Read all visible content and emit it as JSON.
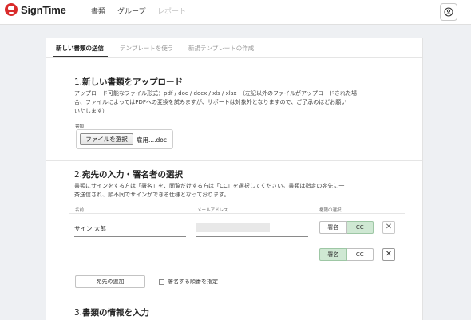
{
  "app": {
    "name": "SignTime"
  },
  "nav": {
    "items": [
      "書類",
      "グループ",
      "レポート"
    ]
  },
  "tabs": [
    "新しい書類の送信",
    "テンプレートを使う",
    "新規テンプレートの作成"
  ],
  "upload": {
    "title_num": "1.",
    "title": "新しい書類をアップロード",
    "desc_line1": "アップロード可能なファイル形式：pdf / doc / docx / xls / xlsx　（左記以外のファイルがアップロードされた場",
    "desc_line2": "合、ファイルによってはPDFへの変換を試みますが、サポートは対象外となりますので、ご了承のほどお願い",
    "desc_line3": "いたします）",
    "file_label": "書類",
    "file_button": "ファイルを選択",
    "file_name": "雇用....doc"
  },
  "recipients": {
    "title_num": "2.",
    "title": "宛先の入力・署名者の選択",
    "desc_line1": "書類にサインをする方は「署名」を、閲覧だけする方は「CC」を選択してください。書類は指定の宛先に一",
    "desc_line2": "斉送信され、順不同でサインができる仕様となっております。",
    "col_name": "名前",
    "col_email": "メールアドレス",
    "col_role": "権限の選択",
    "rows": [
      {
        "name": "サイン 太郎",
        "email": "",
        "sign_label": "署名",
        "cc_label": "CC",
        "selected": "CC"
      },
      {
        "name": "",
        "email": "",
        "sign_label": "署名",
        "cc_label": "CC",
        "selected": "署名"
      }
    ],
    "remove_icon": "✕",
    "add_button": "宛先の追加",
    "order_checkbox_label": "署名する順番を指定"
  },
  "info": {
    "title_num": "3.",
    "title": "書類の情報を入力"
  },
  "colors": {
    "brand": "#d92b2b",
    "toggle_on": "#cfe8d3"
  }
}
